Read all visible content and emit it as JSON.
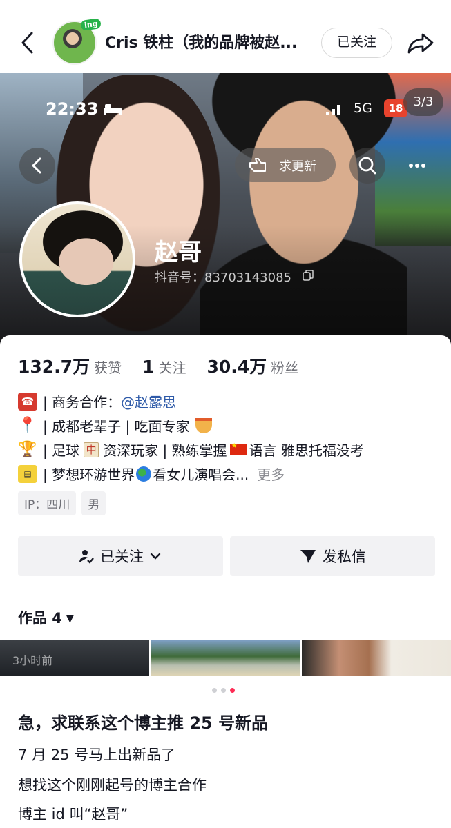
{
  "top_bar": {
    "author_name": "Cris 铁柱（我的品牌被赵...",
    "author_badge": "ing",
    "follow_label": "已关注"
  },
  "screenshot": {
    "status_time": "22:33",
    "network": "5G",
    "battery": "18",
    "page_indicator": "3/3",
    "request_update_label": "求更新",
    "profile_name": "赵哥",
    "profile_id": "抖音号：83703143085"
  },
  "stats": [
    {
      "value": "132.7万",
      "label": "获赞"
    },
    {
      "value": "1",
      "label": "关注"
    },
    {
      "value": "30.4万",
      "label": "粉丝"
    }
  ],
  "bio": {
    "line1_prefix": "| 商务合作：",
    "line1_mention": "@赵露思",
    "line2": "| 成都老辈子 | 吃面专家",
    "line3_a": "| 足球",
    "line3_b": "资深玩家 | 熟练掌握",
    "line3_c": "语言 雅思托福没考",
    "line4_a": "| 梦想环游世界",
    "line4_b": "看女儿演唱会...",
    "more": "更多",
    "mahjong_char": "中"
  },
  "tags": [
    "IP：四川",
    "男"
  ],
  "buttons": {
    "followed": "已关注",
    "message": "发私信"
  },
  "works": {
    "label": "作品 4",
    "thumb_time": "3小时前"
  },
  "post": {
    "title": "急，求联系这个博主推 25 号新品",
    "lines": [
      "7 月 25 号马上出新品了",
      "想找这个刚刚起号的博主合作",
      "博主 id 叫“赵哥”"
    ]
  },
  "carousel": {
    "count": 3,
    "active": 3
  },
  "colors": {
    "accent": "#fe2c55",
    "mention": "#2e5aa8",
    "text": "#161823",
    "secondary": "#6e6f76"
  }
}
